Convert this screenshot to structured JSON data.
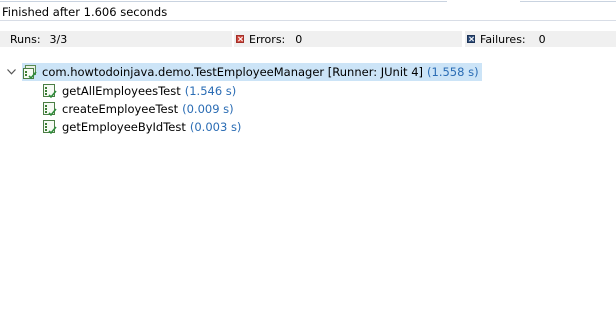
{
  "status": {
    "finished_text": "Finished after 1.606 seconds"
  },
  "counters": {
    "runs_label": "Runs:",
    "runs_value": "3/3",
    "errors_label": "Errors:",
    "errors_value": "0",
    "failures_label": "Failures:",
    "failures_value": "0",
    "errors_icon": "error-icon",
    "failures_icon": "failure-icon",
    "error_color": "#d0463b",
    "failure_color": "#2e4d7a"
  },
  "tree": {
    "root": {
      "name": "com.howtodoinjava.demo.TestEmployeeManager [Runner: JUnit 4]",
      "time": "(1.558 s)",
      "icon": "test-suite-passed-icon",
      "expanded": true
    },
    "tests": [
      {
        "name": "getAllEmployeesTest",
        "time": "(1.546 s)",
        "icon": "test-passed-icon"
      },
      {
        "name": "createEmployeeTest",
        "time": "(0.009 s)",
        "icon": "test-passed-icon"
      },
      {
        "name": "getEmployeeByIdTest",
        "time": "(0.003 s)",
        "icon": "test-passed-icon"
      }
    ]
  },
  "colors": {
    "selection": "#cce4f7",
    "time_text": "#2a6cb4",
    "pass_green": "#2e8b3a"
  }
}
